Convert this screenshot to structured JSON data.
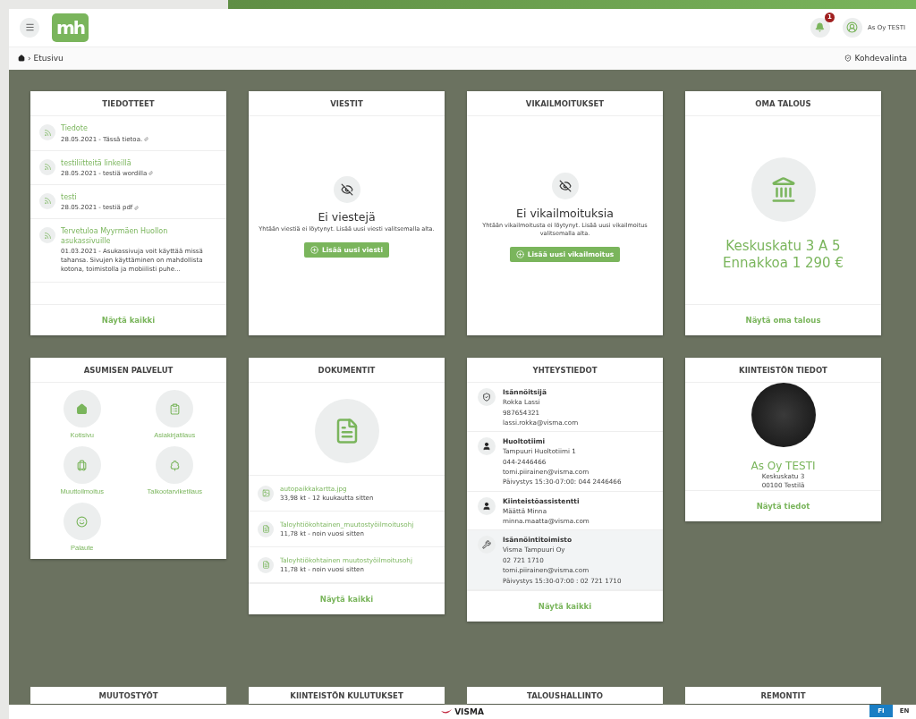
{
  "header": {
    "logo_text": "mh",
    "notifications": {
      "count": "1"
    },
    "user": "As Oy TESTI"
  },
  "breadcrumb": {
    "separator": "›",
    "current": "Etusivu",
    "property_select": "Kohdevalinta"
  },
  "cards": [
    {
      "kind": "news",
      "title": "TIEDOTTEET",
      "items": [
        {
          "title": "Tiedote",
          "meta": "28.05.2021 - Tässä tietoa."
        },
        {
          "title": "testiliitteitä linkeillä",
          "meta": "28.05.2021 - testiä wordilla"
        },
        {
          "title": "testi",
          "meta": "28.05.2021 - testiä pdf"
        },
        {
          "title": "Tervetuloa Myyrmäen Huollon asukassivuille",
          "body": "01.03.2021 - Asukassivuja voit käyttää missä tahansa. Sivujen käyttäminen on mahdollista kotona, toimistolla ja mobiilisti puhe..."
        }
      ],
      "link": "Näytä kaikki"
    },
    {
      "kind": "empty",
      "title": "VIESTIT",
      "heading": "Ei viestejä",
      "text": "Yhtään viestiä ei löytynyt. Lisää uusi viesti valitsemalla alta.",
      "button": "Lisää uusi viesti"
    },
    {
      "kind": "empty",
      "title": "VIKAILMOITUKSET",
      "heading": "Ei vikailmoituksia",
      "text": "Yhtään vikailmoitusta ei löytynyt. Lisää uusi vikailmoitus valitsemalla alta.",
      "button": "Lisää uusi vikailmoitus"
    },
    {
      "kind": "finance",
      "title": "OMA TALOUS",
      "lines": [
        "Keskuskatu 3 A 5",
        "Ennakkoa 1 290 €"
      ],
      "link": "Näytä oma talous"
    },
    {
      "kind": "services",
      "title": "ASUMISEN PALVELUT",
      "services": [
        {
          "kind": "home",
          "label": "Kotisivu"
        },
        {
          "kind": "clipboard",
          "label": "Asiakirjatilaus"
        },
        {
          "kind": "luggage",
          "label": "Muuttoilmoitus"
        },
        {
          "kind": "tree",
          "label": "Talkootarviketilaus"
        },
        {
          "kind": "smile",
          "label": "Palaute"
        }
      ]
    },
    {
      "kind": "documents",
      "title": "DOKUMENTIT",
      "documents": [
        {
          "kind": "image",
          "name": "autopaikkakartta.jpg",
          "meta": "33,98 kt - 12 kuukautta sitten"
        },
        {
          "kind": "file",
          "name": "Taloyhtiökohtainen_muutostyöilmoitusohj",
          "meta": "11,78 kt - noin vuosi sitten"
        },
        {
          "kind": "file",
          "name": "Taloyhtiökohtainen muutostyöilmoitusohj",
          "meta": "11,78 kt - noin vuosi sitten"
        }
      ],
      "link": "Näytä kaikki"
    },
    {
      "kind": "contacts",
      "title": "YHTEYSTIEDOT",
      "contacts": [
        {
          "kind": "shield",
          "role": "Isännöitsijä",
          "highlighted": false,
          "lines": [
            "Rokka Lassi",
            "987654321",
            "lassi.rokka@visma.com"
          ]
        },
        {
          "kind": "person",
          "role": "Huoltotiimi",
          "highlighted": false,
          "lines": [
            "Tampuuri Huoltotiimi 1",
            "044-2446466",
            "tomi.piirainen@visma.com",
            "Päivystys 15:30-07:00: 044 2446466"
          ]
        },
        {
          "kind": "person",
          "role": "Kiinteistöassistentti",
          "highlighted": false,
          "lines": [
            "Määttä Minna",
            "minna.maatta@visma.com"
          ]
        },
        {
          "kind": "wrench",
          "role": "Isännöintitoimisto",
          "highlighted": true,
          "lines": [
            "Visma Tampuuri Oy",
            "02 721 1710",
            "tomi.piirainen@visma.com",
            "Päivystys 15:30-07:00 : 02 721 1710"
          ]
        }
      ],
      "link": "Näytä kaikki"
    },
    {
      "kind": "property",
      "title": "KIINTEISTÖN TIEDOT",
      "name": "As Oy TESTI",
      "address": [
        "Keskuskatu 3",
        "00100 Testilä"
      ],
      "link": "Näytä tiedot"
    },
    {
      "kind": "stub",
      "title": "MUUTOSTYÖT"
    },
    {
      "kind": "stub",
      "title": "KIINTEISTÖN KULUTUKSET"
    },
    {
      "kind": "stub",
      "title": "TALOUSHALLINTO"
    },
    {
      "kind": "stub",
      "title": "REMONTIT"
    }
  ],
  "footer": {
    "logo": "VISMA",
    "languages": [
      {
        "label": "FI",
        "selected": true
      },
      {
        "label": "EN",
        "selected": false
      }
    ]
  }
}
